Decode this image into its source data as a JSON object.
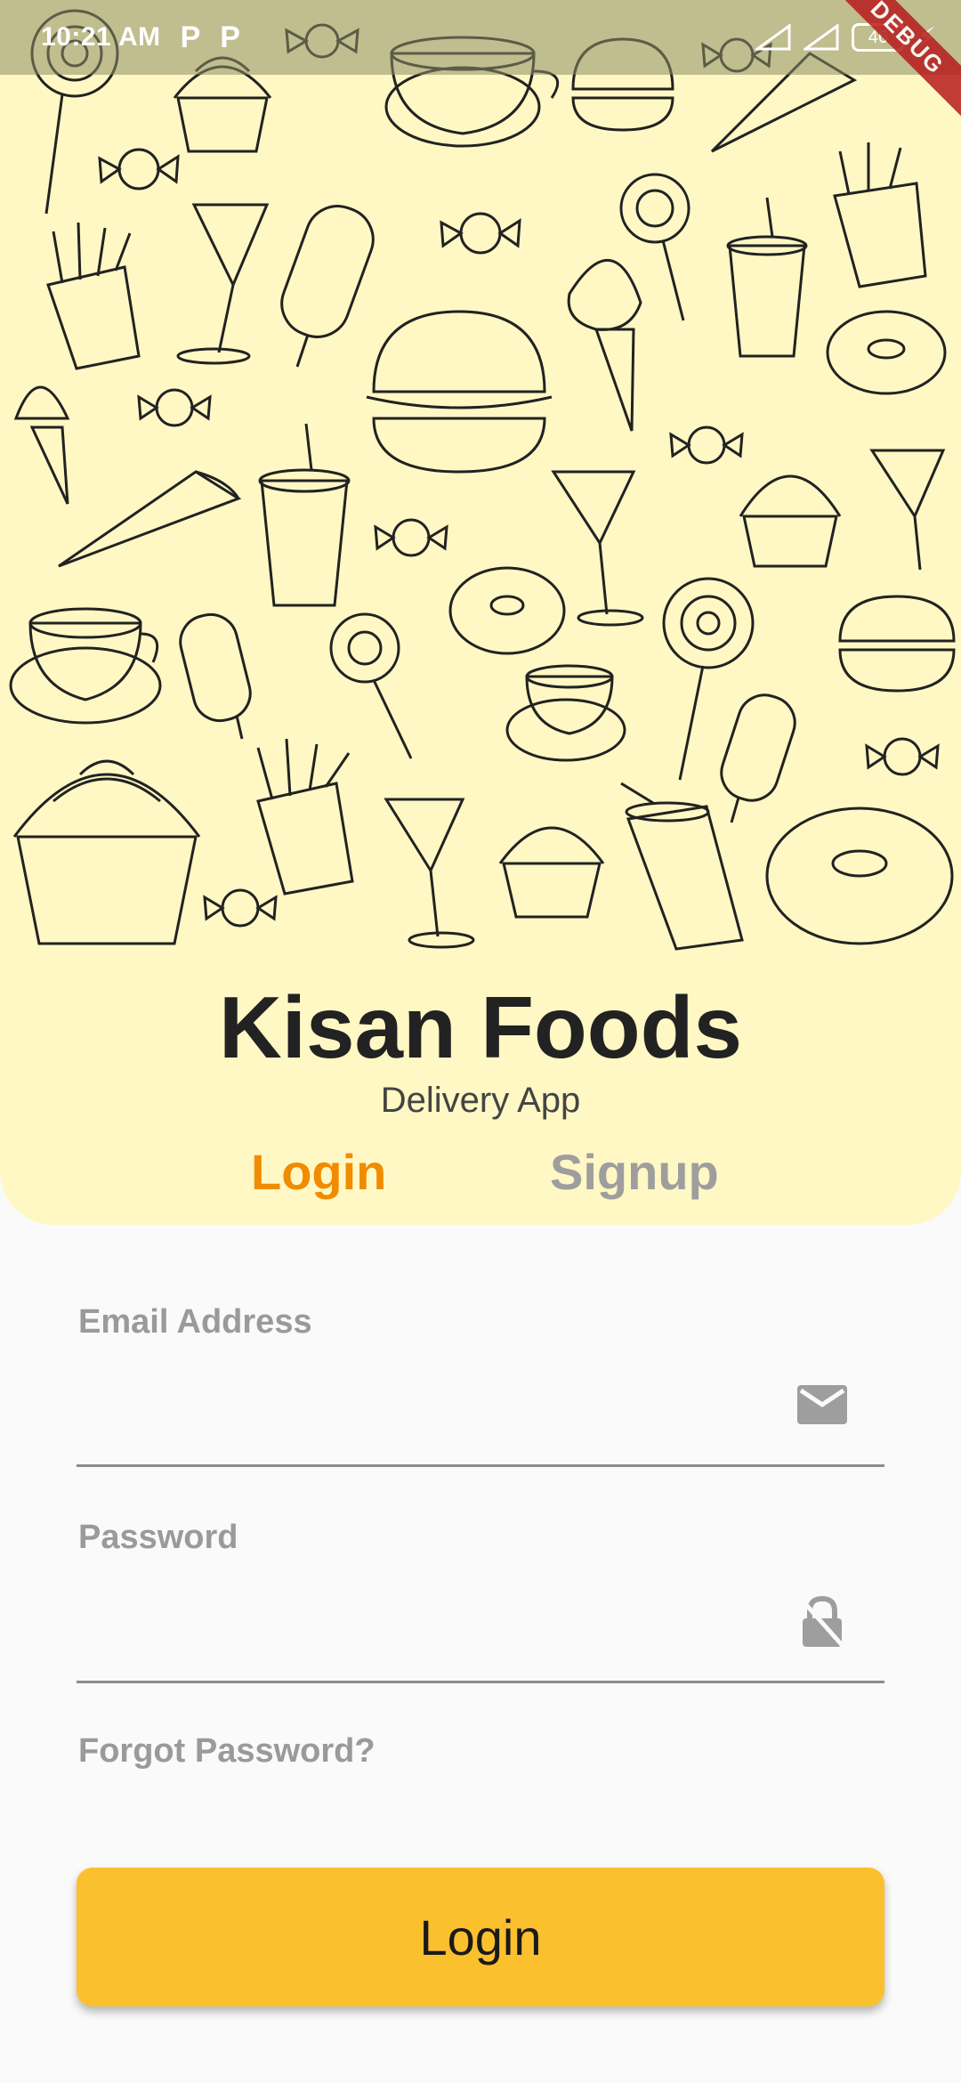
{
  "status_bar": {
    "time": "10:21 AM",
    "notif_icons": [
      "P",
      "P"
    ],
    "battery": "46",
    "debug_banner": "DEBUG"
  },
  "app": {
    "title": "Kisan Foods",
    "subtitle": "Delivery App"
  },
  "tabs": [
    {
      "label": "Login",
      "active": true
    },
    {
      "label": "Signup",
      "active": false
    }
  ],
  "form": {
    "email_label": "Email Address",
    "email_value": "",
    "email_icon": "mail-icon",
    "password_label": "Password",
    "password_value": "",
    "password_icon": "lock-icon",
    "forgot_label": "Forgot Password?",
    "submit_label": "Login"
  },
  "colors": {
    "header_bg": "#fff8c4",
    "active_tab": "#f08c00",
    "inactive_tab": "#9e9e9e",
    "button": "#fbc02d"
  }
}
